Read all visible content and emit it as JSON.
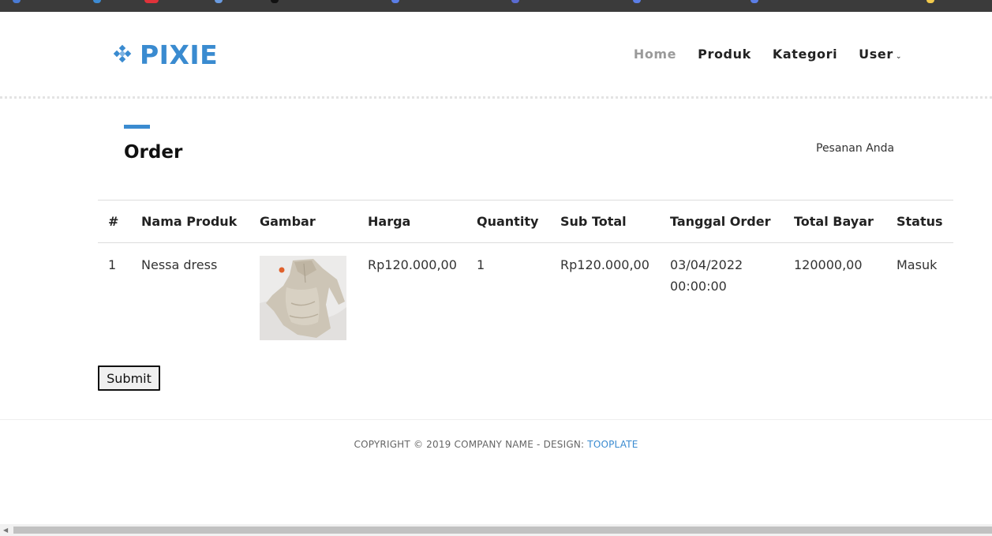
{
  "brand": {
    "name": "PIXIE",
    "color": "#3a8bd0"
  },
  "nav": {
    "items": [
      {
        "label": "Home",
        "active": true
      },
      {
        "label": "Produk",
        "active": false
      },
      {
        "label": "Kategori",
        "active": false
      },
      {
        "label": "User",
        "active": false,
        "has_dropdown": true
      }
    ]
  },
  "page": {
    "title": "Order",
    "subtitle": "Pesanan Anda"
  },
  "table": {
    "headers": [
      "#",
      "Nama Produk",
      "Gambar",
      "Harga",
      "Quantity",
      "Sub Total",
      "Tanggal Order",
      "Total Bayar",
      "Status"
    ],
    "rows": [
      {
        "no": "1",
        "name": "Nessa dress",
        "image": "dress-photo",
        "price": "Rp120.000,00",
        "quantity": "1",
        "subtotal": "Rp120.000,00",
        "date": "03/04/2022",
        "time": "00:00:00",
        "total": "120000,00",
        "status": "Masuk"
      }
    ]
  },
  "form": {
    "submit_label": "Submit"
  },
  "footer": {
    "copyright": "COPYRIGHT © 2019 COMPANY NAME - DESIGN: ",
    "design_link": "TOOPLATE"
  },
  "icons": {
    "logo": "diamond-pixel-icon",
    "nav_caret": "chevron-down-icon"
  }
}
